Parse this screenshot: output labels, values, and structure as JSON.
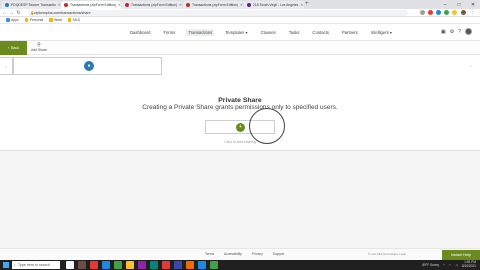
{
  "browser": {
    "tabs": [
      {
        "label": "PDQDESP Secure Transactio",
        "favicon_color": "#2a7ab5",
        "active": false
      },
      {
        "label": "Transactions (zipForm Edition)",
        "favicon_color": "#c62828",
        "active": true
      },
      {
        "label": "Transactions (zipForm Edition)",
        "favicon_color": "#c62828",
        "active": false
      },
      {
        "label": "Transactions (zipForm Edition)",
        "favicon_color": "#c62828",
        "active": false
      },
      {
        "label": "218 South Virgil - Los Angeles",
        "favicon_color": "#6a1b9a",
        "active": false
      }
    ],
    "new_tab": "+",
    "url": "zipformplus.com/transactions/share",
    "bookmarks": [
      {
        "label": "Apps",
        "color": "#4a90d9"
      },
      {
        "label": "Personal",
        "color": "#f4b400"
      },
      {
        "label": "Work",
        "color": "#f4b400"
      },
      {
        "label": "MLS",
        "color": "#f4b400"
      }
    ]
  },
  "header": {
    "nav": [
      {
        "label": "Dashboard",
        "active": false
      },
      {
        "label": "Forms",
        "active": false
      },
      {
        "label": "Transactions",
        "active": true
      },
      {
        "label": "Templates ▾",
        "active": false
      },
      {
        "label": "Clauses",
        "active": false
      },
      {
        "label": "Tasks",
        "active": false
      },
      {
        "label": "Contacts",
        "active": false
      },
      {
        "label": "Partners",
        "active": false
      },
      {
        "label": "Intelligent ▾",
        "active": false
      }
    ]
  },
  "toolbar": {
    "back_label": "Back",
    "add_share_label": "Add Share"
  },
  "share": {
    "title": "Private Share",
    "subtitle": "Creating a Private Share grants permissions only to specified users.",
    "hint": "Click to add sharing"
  },
  "footer": {
    "links": [
      "Terms",
      "Accessibility",
      "Privacy",
      "Support"
    ],
    "copyright": "© Lone Wolf Technologies. Legal",
    "instant_help": "Instant Help"
  },
  "taskbar": {
    "search_placeholder": "Type here to search",
    "weather": "89°F Sunny",
    "time": "1:53 PM",
    "date": "8/10/2021",
    "app_colors": [
      "#f5f5f5",
      "#6d4c41",
      "#e53935",
      "#1e88e5",
      "#43a047",
      "#fbc02d",
      "#8e24aa",
      "#00897b",
      "#e53935",
      "#3949ab",
      "#ef6c00",
      "#1e88e5",
      "#43a047"
    ]
  },
  "colors": {
    "accent_green": "#6a8c1f",
    "info_blue": "#2a7ab5"
  }
}
